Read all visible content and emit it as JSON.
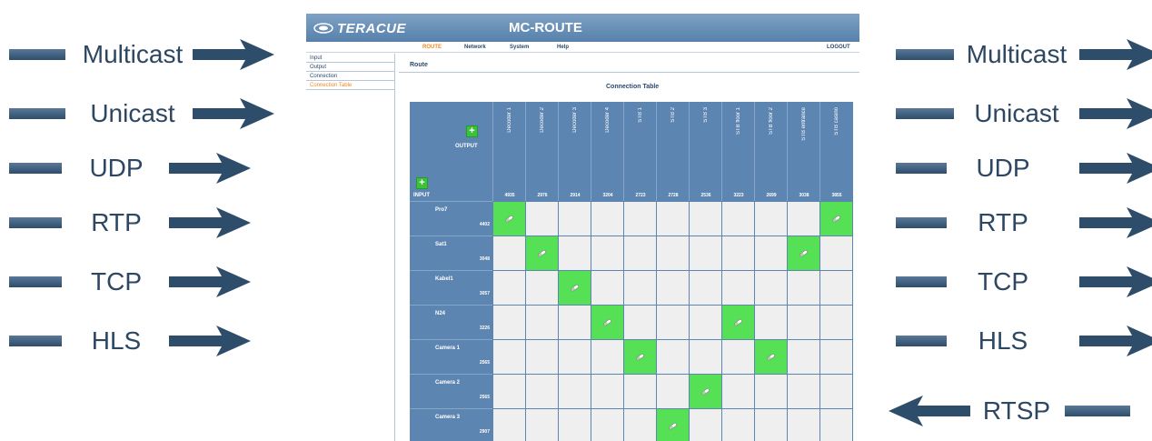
{
  "left_protocols": [
    "Multicast",
    "Unicast",
    "UDP",
    "RTP",
    "TCP",
    "HLS"
  ],
  "right_protocols": [
    "Multicast",
    "Unicast",
    "UDP",
    "RTP",
    "TCP",
    "HLS"
  ],
  "right_input_protocol": "RTSP",
  "colors": {
    "arrow": "#2e4d6b",
    "header_blue": "#5d85b1",
    "active_cell": "#55e055",
    "accent_orange": "#f08a24"
  },
  "app": {
    "logo": "TERACUE",
    "title": "MC-ROUTE",
    "menu": [
      {
        "label": "ROUTE",
        "active": true
      },
      {
        "label": "Network",
        "active": false
      },
      {
        "label": "System",
        "active": false
      },
      {
        "label": "Help",
        "active": false
      }
    ],
    "logout": "LOGOUT",
    "sidebar": [
      {
        "label": "Input",
        "active": false
      },
      {
        "label": "Output",
        "active": false
      },
      {
        "label": "Connection",
        "active": false
      },
      {
        "label": "Connection Table",
        "active": true
      }
    ],
    "breadcrumb": "Route",
    "table_title": "Connection Table"
  },
  "matrix": {
    "output_label": "OUTPUT",
    "input_label": "INPUT",
    "outputs": [
      {
        "name": "Decoder 1",
        "port": "4935"
      },
      {
        "name": "Decoder 2",
        "port": "2976"
      },
      {
        "name": "Decoder 3",
        "port": "2914"
      },
      {
        "name": "Decoder 4",
        "port": "3204"
      },
      {
        "name": "STB 1",
        "port": "2723"
      },
      {
        "name": "STB 2",
        "port": "2728"
      },
      {
        "name": "STB 3",
        "port": "2536"
      },
      {
        "name": "STB floor 1",
        "port": "3223"
      },
      {
        "name": "STB floor 2",
        "port": "2699"
      },
      {
        "name": "STB entrance",
        "port": "3038"
      },
      {
        "name": "STB casino",
        "port": "3855"
      }
    ],
    "inputs": [
      {
        "name": "Pro7",
        "port": "4402"
      },
      {
        "name": "Sat1",
        "port": "3048"
      },
      {
        "name": "Kabel1",
        "port": "3057"
      },
      {
        "name": "N24",
        "port": "3226"
      },
      {
        "name": "Camera 1",
        "port": "2565"
      },
      {
        "name": "Camera 2",
        "port": "2565"
      },
      {
        "name": "Camera 3",
        "port": "2907"
      }
    ],
    "connections": [
      [
        0,
        0
      ],
      [
        0,
        10
      ],
      [
        1,
        1
      ],
      [
        1,
        9
      ],
      [
        2,
        2
      ],
      [
        3,
        3
      ],
      [
        3,
        7
      ],
      [
        4,
        4
      ],
      [
        4,
        8
      ],
      [
        5,
        6
      ],
      [
        6,
        5
      ]
    ]
  }
}
